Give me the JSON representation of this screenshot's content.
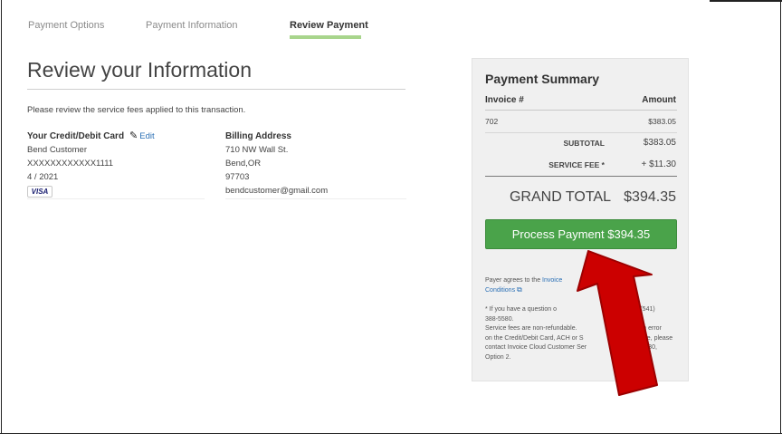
{
  "steps": {
    "payment_options": "Payment Options",
    "payment_information": "Payment Information",
    "review_payment": "Review Payment"
  },
  "page": {
    "title": "Review your Information",
    "intro": "Please review the service fees applied to this transaction."
  },
  "card": {
    "heading": "Your Credit/Debit Card",
    "edit_label": "Edit",
    "name": "Bend Customer",
    "number": "XXXXXXXXXXXX1111",
    "expiry": "4 / 2021",
    "brand": "VISA"
  },
  "billing": {
    "heading": "Billing Address",
    "street": "710 NW Wall St.",
    "city_state": "Bend,OR",
    "zip": "97703",
    "email": "bendcustomer@gmail.com"
  },
  "summary": {
    "title": "Payment Summary",
    "col_invoice": "Invoice #",
    "col_amount": "Amount",
    "invoice_number": "702",
    "invoice_amount": "$383.05",
    "subtotal_label": "SUBTOTAL",
    "subtotal_value": "$383.05",
    "fee_label": "SERVICE FEE *",
    "fee_value": "+ $11.30",
    "grand_total_label": "GRAND TOTAL",
    "grand_total_value": "$394.35",
    "pay_button": "Process Payment $394.35",
    "agree_prefix": "Payer agrees to the",
    "agree_link_1": "Invoice",
    "agree_link_2": "nd",
    "agree_link_3": "Conditions",
    "note_1a": "* If you have a question o",
    "note_1b": "tact us at (541)",
    "note_1c": "388-5580.",
    "note_2a": "Service fees are non-refundable.",
    "note_2b": "e is an error",
    "note_3a": "on the Credit/Debit Card, ACH or S",
    "note_3b": "rge, please",
    "note_4a": "contact Invoice Cloud Customer Ser",
    "note_4b": "-8330,",
    "note_5": "Option 2."
  },
  "colors": {
    "accent_green": "#4aa34a",
    "step_underline": "#a8d58c",
    "link_blue": "#2a6fb5",
    "arrow_red": "#cc0000"
  },
  "icons": [
    "pencil-icon",
    "external-link-icon",
    "red-arrow-annotation"
  ]
}
